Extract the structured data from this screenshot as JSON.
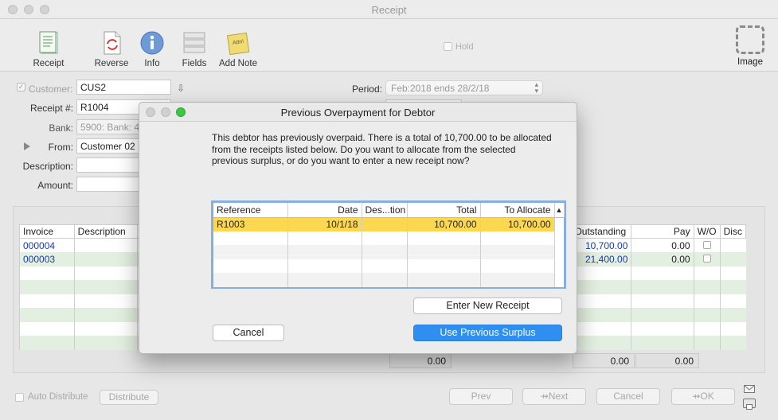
{
  "window": {
    "title": "Receipt"
  },
  "toolbar": {
    "receipt": "Receipt",
    "reverse": "Reverse",
    "info": "Info",
    "fields": "Fields",
    "add_note": "Add Note",
    "note_sticker": "Attn!",
    "hold": "Hold",
    "image": "Image"
  },
  "form": {
    "customer_label": "Customer:",
    "customer_value": "CUS2",
    "receipt_label": "Receipt #:",
    "receipt_value": "R1004",
    "bank_label": "Bank:",
    "bank_value": "5900: Bank: 4",
    "from_label": "From:",
    "from_value": "Customer 02",
    "description_label": "Description:",
    "description_value": "",
    "amount_label": "Amount:",
    "amount_value": "0.0",
    "period_label": "Period:",
    "period_value": "Feb:2018 ends 28/2/18"
  },
  "invoices": {
    "headers": [
      "Invoice",
      "Description",
      "Outstanding",
      "Pay",
      "W/O",
      "Disc"
    ],
    "rows": [
      {
        "invoice": "000004",
        "outstanding": "10,700.00",
        "pay": "0.00"
      },
      {
        "invoice": "000003",
        "outstanding": "21,400.00",
        "pay": "0.00"
      }
    ],
    "totals": {
      "left": "0.00",
      "outstanding": "0.00",
      "pay": "0.00"
    }
  },
  "bottom": {
    "auto_distribute": "Auto Distribute",
    "distribute": "Distribute",
    "prev": "Prev",
    "next": "Next",
    "cancel": "Cancel",
    "ok": "OK"
  },
  "dialog": {
    "title": "Previous Overpayment for Debtor",
    "message": "This debtor has previously overpaid. There is a total of 10,700.00 to be allocated from the receipts listed below. Do you want to allocate from the selected previous surplus, or do you want to enter a new receipt now?",
    "columns": [
      "Reference",
      "Date",
      "Des...tion",
      "Total",
      "To Allocate"
    ],
    "rows": [
      {
        "reference": "R1003",
        "date": "10/1/18",
        "description": "",
        "total": "10,700.00",
        "to_allocate": "10,700.00"
      }
    ],
    "enter_new_receipt": "Enter New Receipt",
    "cancel": "Cancel",
    "use_previous_surplus": "Use Previous Surplus"
  },
  "colors": {
    "selection": "#fbd84f",
    "primary_button": "#2f8ef0",
    "link": "#1a3ea8",
    "row_alt": "#e3efe0"
  }
}
